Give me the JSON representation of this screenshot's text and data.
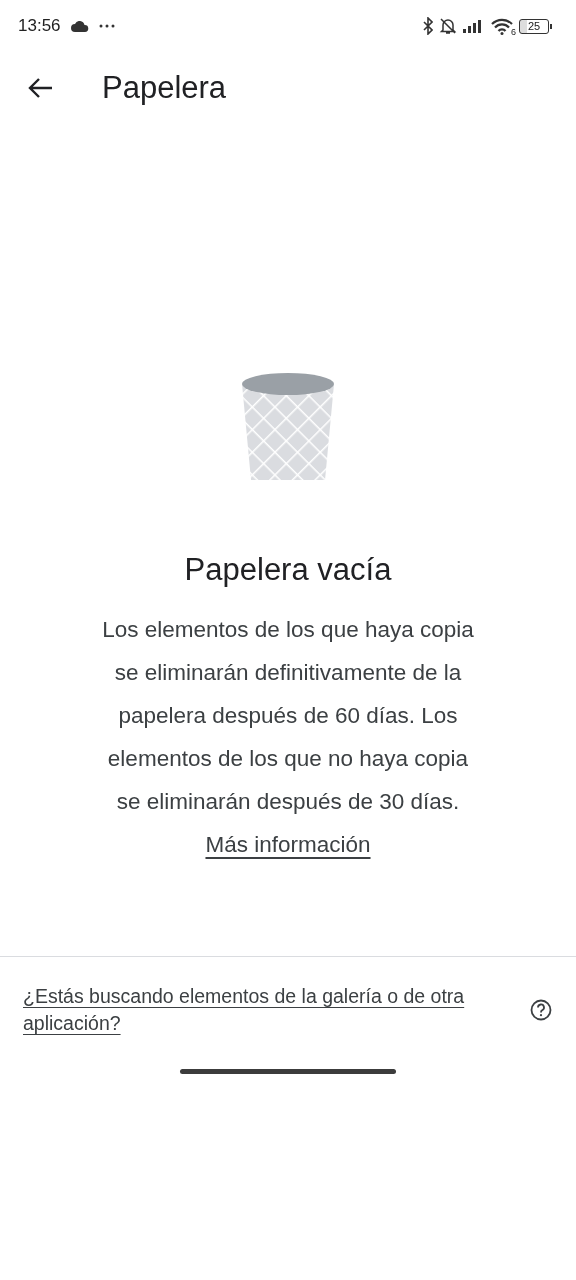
{
  "status_bar": {
    "time": "13:56",
    "wifi_band": "6",
    "battery": "25"
  },
  "app_bar": {
    "title": "Papelera"
  },
  "empty_state": {
    "title": "Papelera vacía",
    "message": "Los elementos de los que haya copia se eliminarán definitivamente de la papelera después de 60 días. Los elementos de los que no haya copia se eliminarán después de 30 días.",
    "link": "Más información"
  },
  "footer": {
    "link": "¿Estás buscando elementos de la galería o de otra aplicación?"
  }
}
